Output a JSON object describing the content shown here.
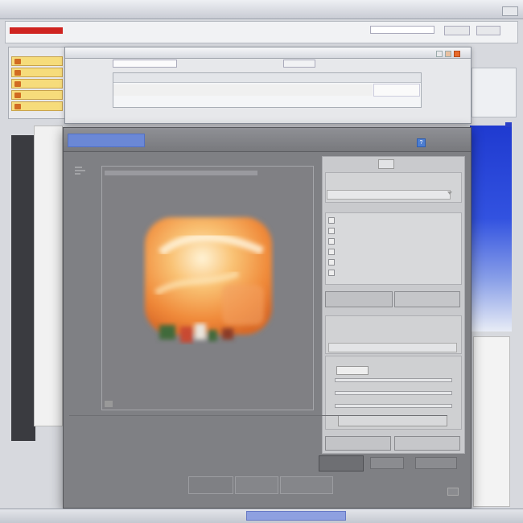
{
  "background_window": {
    "title": "",
    "close_label": "",
    "page_subtitle": "",
    "address": "",
    "toolbar_buttons": [
      "",
      ""
    ],
    "left_items": [
      "",
      "",
      "",
      "",
      ""
    ],
    "right_items": [
      "",
      "",
      "",
      "",
      ""
    ],
    "side_label": ""
  },
  "middle_window": {
    "title": "",
    "field1": "",
    "field2": "",
    "side_items": [
      "",
      "",
      "",
      "",
      ""
    ],
    "table_header": "",
    "row_cells": [
      "",
      "",
      "",
      ""
    ],
    "row_right": "",
    "right_buttons": [
      "",
      ""
    ],
    "status_label": "",
    "status_text": "",
    "status_value": "",
    "status_right": ""
  },
  "dialog": {
    "title": "",
    "help_icon_glyph": "?",
    "path_text": "",
    "preview": {
      "caption": "",
      "subcaption": ""
    },
    "right_panel": {
      "top_label": "",
      "group1_label": "",
      "group1_value": "",
      "list_label": "",
      "list_footer": "",
      "button_a": "",
      "button_b": "",
      "group2_label": "",
      "group2_line": "",
      "group2_value": "",
      "group3_label": "",
      "group3_select": "",
      "group3_right": "",
      "slider_labels": [
        "",
        "",
        ""
      ],
      "group3_button": "",
      "button_c": "",
      "button_d": ""
    },
    "info": {
      "label1": "",
      "value1": "",
      "label2": "",
      "value2": "",
      "label3": "",
      "value3": "",
      "value3b": "",
      "value3c": ""
    },
    "bottom_buttons": [
      "",
      "",
      ""
    ],
    "footer_buttons": [
      "",
      "",
      ""
    ]
  },
  "taskbar": {
    "left": "",
    "center": "",
    "right": ""
  },
  "colors": {
    "dialog_bg": "#7f8084",
    "title_highlight": "#6b88d6",
    "accent_red": "#cf2420",
    "accent_blue": "#1f3ad0",
    "thumb_orange": "#f08a3a"
  },
  "icons": [
    "help-icon",
    "image-thumbnail-icon",
    "checkbox-icon",
    "dropdown-arrow-icon"
  ]
}
